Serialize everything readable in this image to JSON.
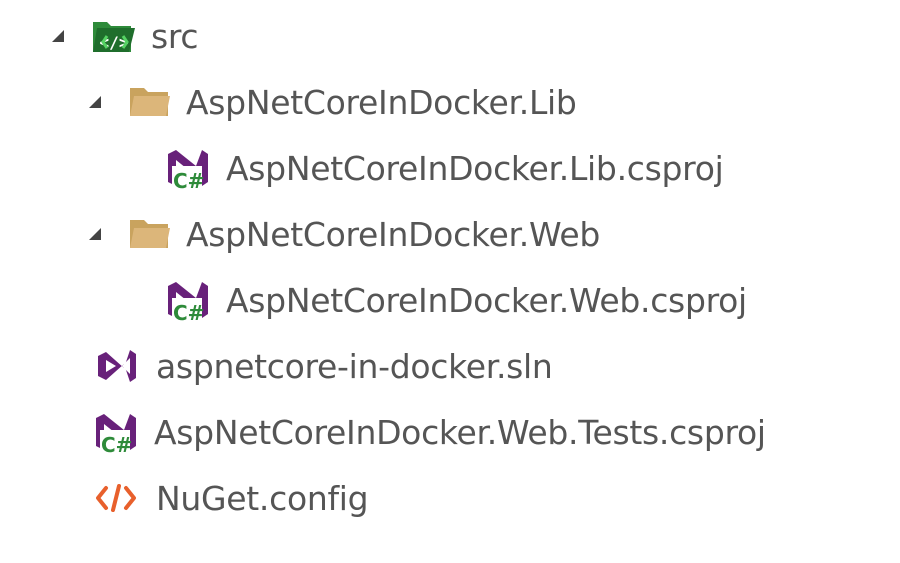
{
  "tree": {
    "items": [
      {
        "label": "src",
        "icon": "folder-code-icon",
        "expanded": true
      },
      {
        "label": "AspNetCoreInDocker.Lib",
        "icon": "folder-icon",
        "expanded": true
      },
      {
        "label": "AspNetCoreInDocker.Lib.csproj",
        "icon": "csharp-project-icon"
      },
      {
        "label": "AspNetCoreInDocker.Web",
        "icon": "folder-icon",
        "expanded": true
      },
      {
        "label": "AspNetCoreInDocker.Web.csproj",
        "icon": "csharp-project-icon"
      },
      {
        "label": "aspnetcore-in-docker.sln",
        "icon": "visual-studio-solution-icon"
      },
      {
        "label": "AspNetCoreInDocker.Web.Tests.csproj",
        "icon": "csharp-project-icon"
      },
      {
        "label": "NuGet.config",
        "icon": "xml-config-icon"
      }
    ]
  },
  "colors": {
    "text": "#555555",
    "expander": "#444444",
    "folder_code_green": "#2e8b3a",
    "folder_tan": "#dcb67a",
    "vs_purple": "#68217a",
    "csharp_green": "#2e8b3a",
    "config_orange": "#e8602c"
  }
}
